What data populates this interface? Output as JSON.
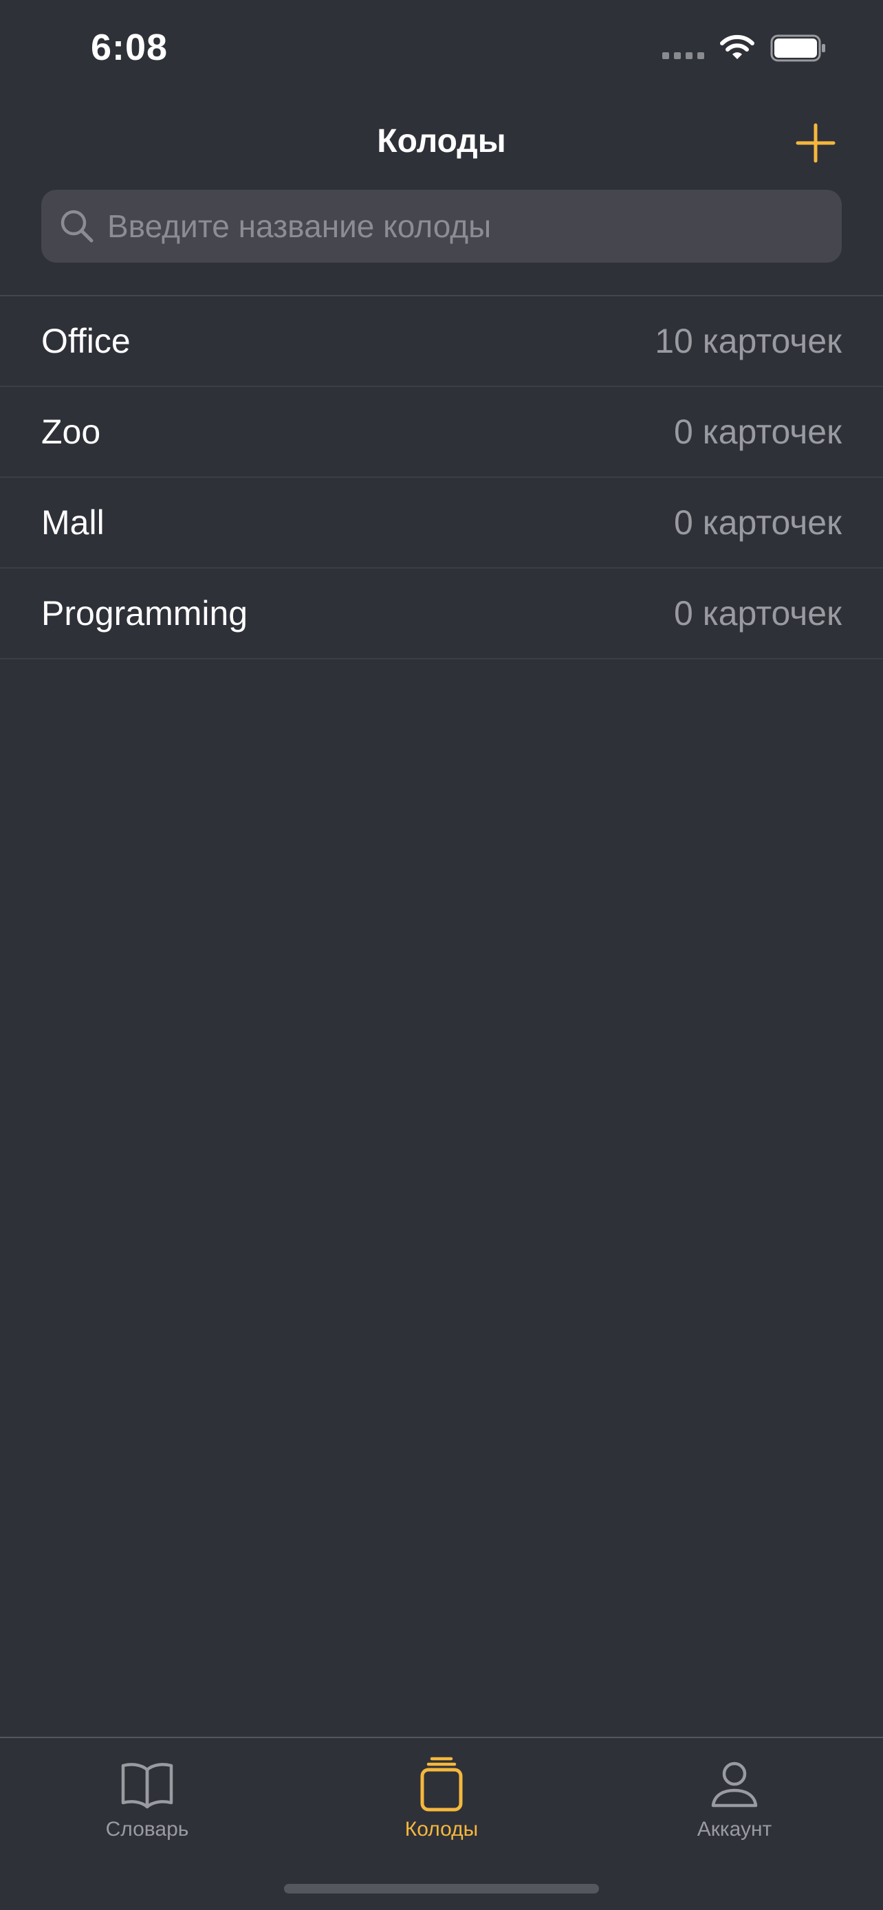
{
  "status_bar": {
    "time": "6:08"
  },
  "nav": {
    "title": "Колоды",
    "add_icon": "plus-icon"
  },
  "search": {
    "placeholder": "Введите название колоды",
    "value": ""
  },
  "decks": [
    {
      "name": "Office",
      "count": "10 карточек"
    },
    {
      "name": "Zoo",
      "count": "0 карточек"
    },
    {
      "name": "Mall",
      "count": "0 карточек"
    },
    {
      "name": "Programming",
      "count": "0 карточек"
    }
  ],
  "tabs": [
    {
      "label": "Словарь",
      "icon": "book-icon",
      "active": false
    },
    {
      "label": "Колоды",
      "icon": "cards-stack-icon",
      "active": true
    },
    {
      "label": "Аккаунт",
      "icon": "person-icon",
      "active": false
    }
  ],
  "colors": {
    "accent": "#f5b83d",
    "background": "#2f3139",
    "secondary_text": "#9a9ba1"
  }
}
